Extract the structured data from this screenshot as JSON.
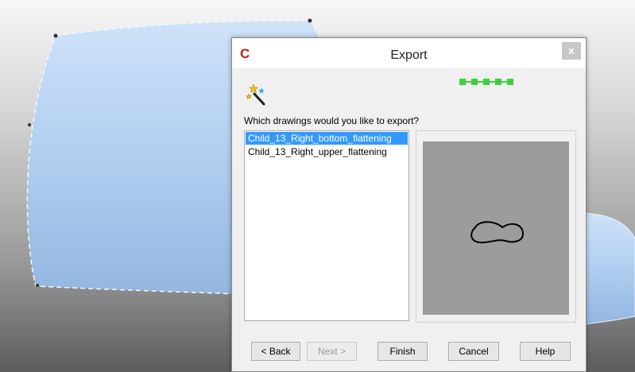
{
  "dialog": {
    "title": "Export",
    "close_glyph": "x",
    "app_logo_glyph": "C",
    "prompt": "Which drawings would you like to export?",
    "drawings": [
      {
        "label": "Child_13_Right_bottom_flattening",
        "selected": true
      },
      {
        "label": "Child_13_Right_upper_flattening",
        "selected": false
      }
    ],
    "step_count": 5,
    "buttons": {
      "back": "< Back",
      "next": "Next >",
      "finish": "Finish",
      "cancel": "Cancel",
      "help": "Help"
    }
  },
  "icons": {
    "wizard": "magic-wand-icon",
    "close": "close-icon",
    "app": "app-logo-icon"
  },
  "colors": {
    "selection": "#3399ff",
    "step_green": "#3ecf3e",
    "model_blue": "#b7d3f3",
    "logo_red": "#c31b1b"
  }
}
